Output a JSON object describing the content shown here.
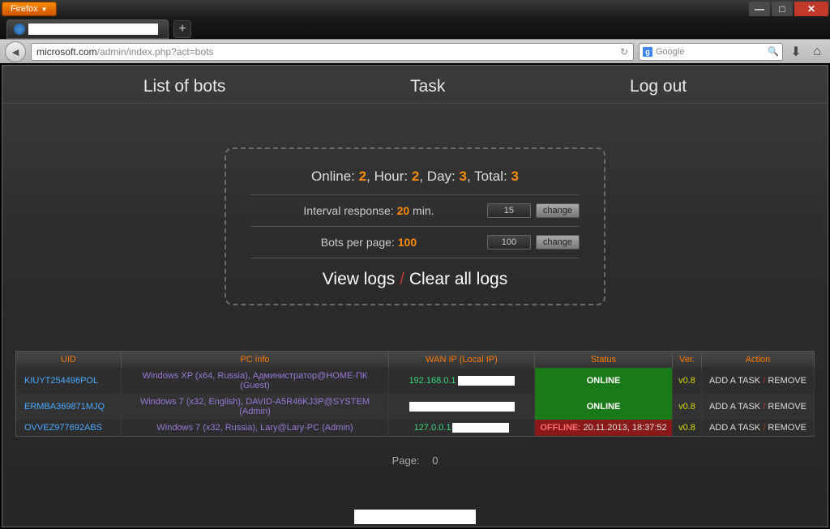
{
  "window": {
    "firefox_label": "Firefox",
    "tab_new": "+"
  },
  "nav": {
    "url_host": "microsoft.com",
    "url_path": "/admin/index.php?act=bots",
    "search_placeholder": "Google"
  },
  "topnav": {
    "list_label": "List of bots",
    "task_label": "Task",
    "logout_label": "Log out"
  },
  "stats": {
    "online_label": "Online:",
    "online_value": "2",
    "hour_label": "Hour:",
    "hour_value": "2",
    "day_label": "Day:",
    "day_value": "3",
    "total_label": "Total:",
    "total_value": "3",
    "interval_label": "Interval response:",
    "interval_value": "20",
    "interval_unit": "min.",
    "interval_input": "15",
    "bpp_label": "Bots per page:",
    "bpp_value": "100",
    "bpp_input": "100",
    "change_label": "change",
    "viewlogs_label": "View logs",
    "clearlogs_label": "Clear all logs"
  },
  "table": {
    "headers": {
      "uid": "UID",
      "pcinfo": "PC info",
      "wanip": "WAN IP (Local IP)",
      "status": "Status",
      "ver": "Ver.",
      "action": "Action"
    },
    "rows": [
      {
        "uid": "KIUYT254496POL",
        "pcinfo": "Windows XP (x64, Russia), Администратор@HOME-ПК (Guest)",
        "ip": "192.168.0.1",
        "status": "ONLINE",
        "status_type": "online",
        "ver": "v0.8",
        "add": "ADD A TASK",
        "remove": "REMOVE"
      },
      {
        "uid": "ERMBA369871MJQ",
        "pcinfo": "Windows 7 (x32, English), DAVID-A5R46KJ3P@SYSTEM (Admin)",
        "ip": "",
        "status": "ONLINE",
        "status_type": "online",
        "ver": "v0.8",
        "add": "ADD A TASK",
        "remove": "REMOVE"
      },
      {
        "uid": "OVVEZ977692ABS",
        "pcinfo": "Windows 7 (x32, Russia), Lary@Lary-PC (Admin)",
        "ip": "127.0.0.1",
        "status_label": "OFFLINE",
        "status_time": ": 20.11.2013, 18:37:52",
        "status_type": "offline",
        "ver": "v0.8",
        "add": "ADD A TASK",
        "remove": "REMOVE"
      }
    ],
    "pager_label": "Page:",
    "pager_value": "0"
  }
}
